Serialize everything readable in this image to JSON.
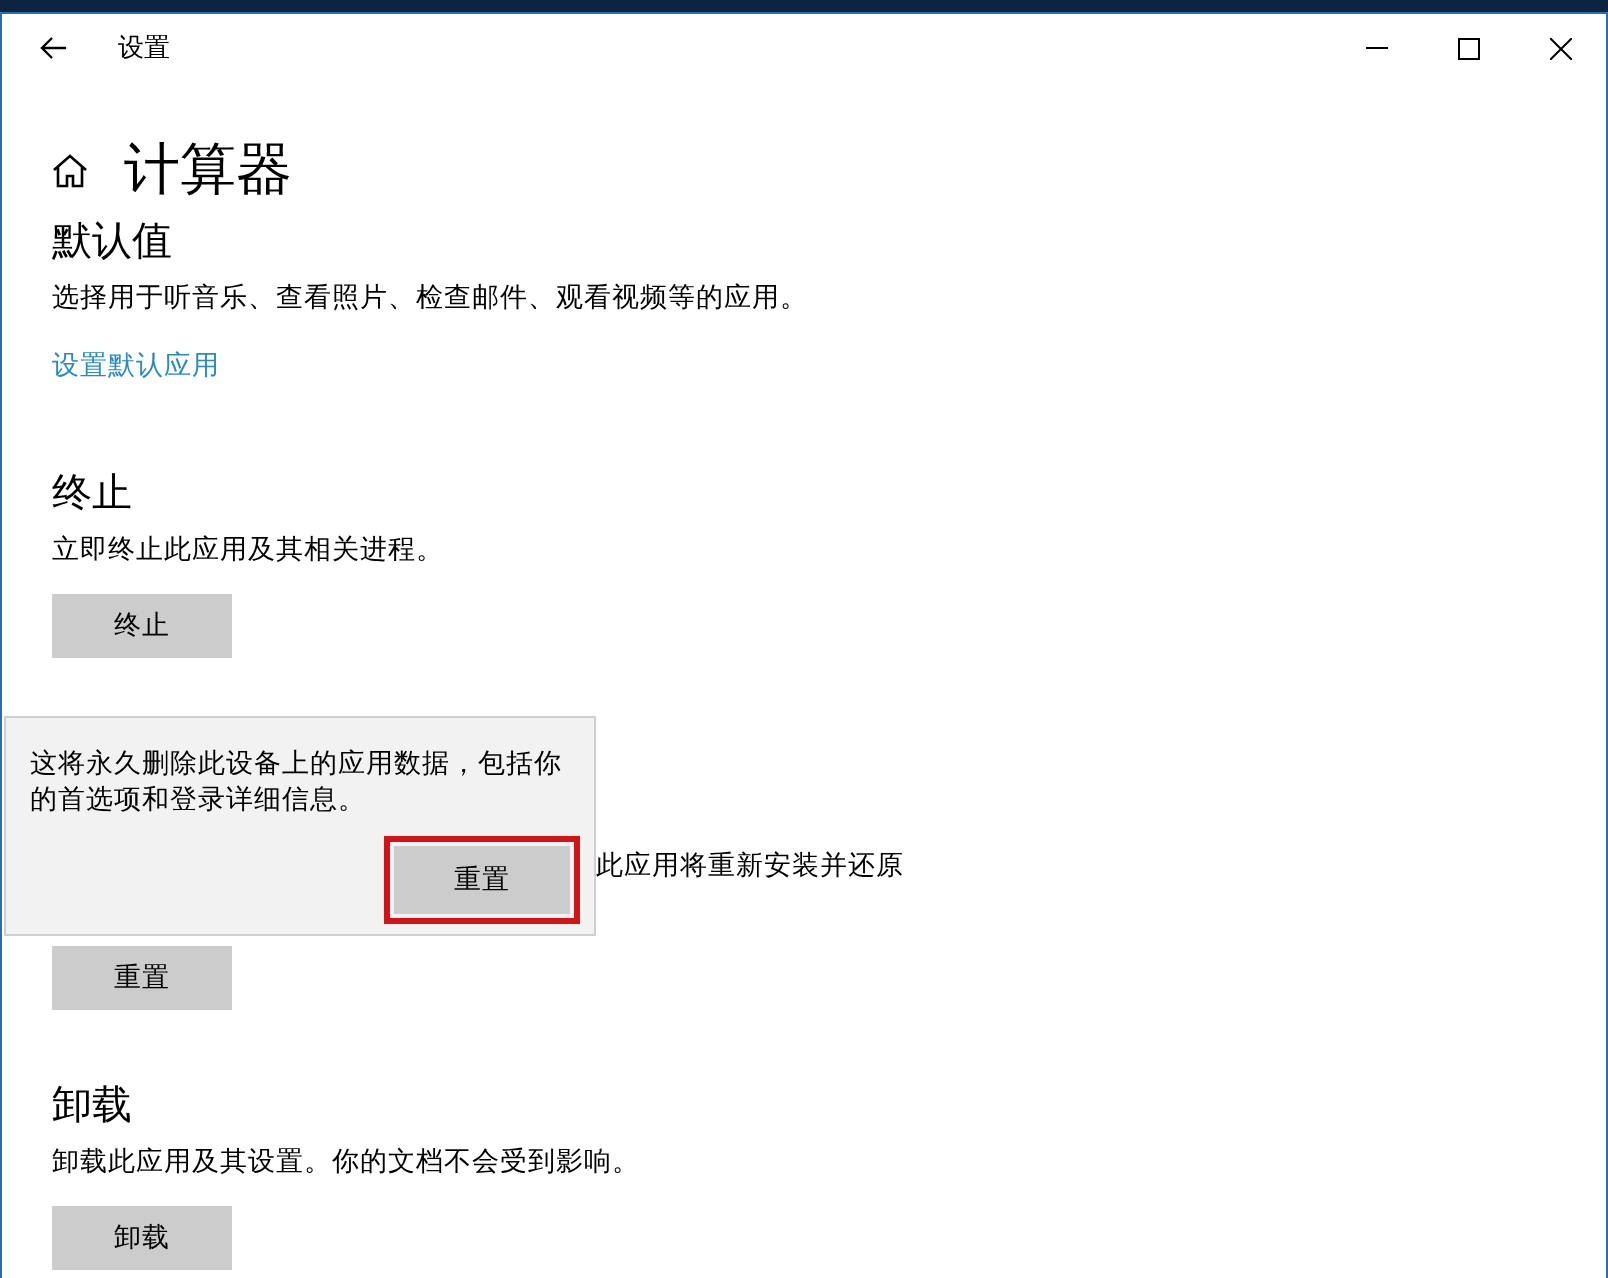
{
  "window": {
    "title": "设置"
  },
  "page": {
    "title": "计算器"
  },
  "sections": [
    {
      "kind": "link",
      "heading": "默认值",
      "description": "选择用于听音乐、查看照片、检查邮件、观看视频等的应用。",
      "link": "设置默认应用"
    },
    {
      "kind": "button",
      "heading": "终止",
      "description": "立即终止此应用及其相关进程。",
      "button": "终止"
    },
    {
      "kind": "covered",
      "description": "此应用将重新安装并还原",
      "button": "重置"
    },
    {
      "kind": "button",
      "heading": "卸载",
      "description": "卸载此应用及其设置。你的文档不会受到影响。",
      "button": "卸载"
    }
  ],
  "flyout": {
    "message": "这将永久删除此设备上的应用数据，包括你的首选项和登录详细信息。",
    "button": {
      "label": "重置",
      "highlighted": true
    }
  }
}
